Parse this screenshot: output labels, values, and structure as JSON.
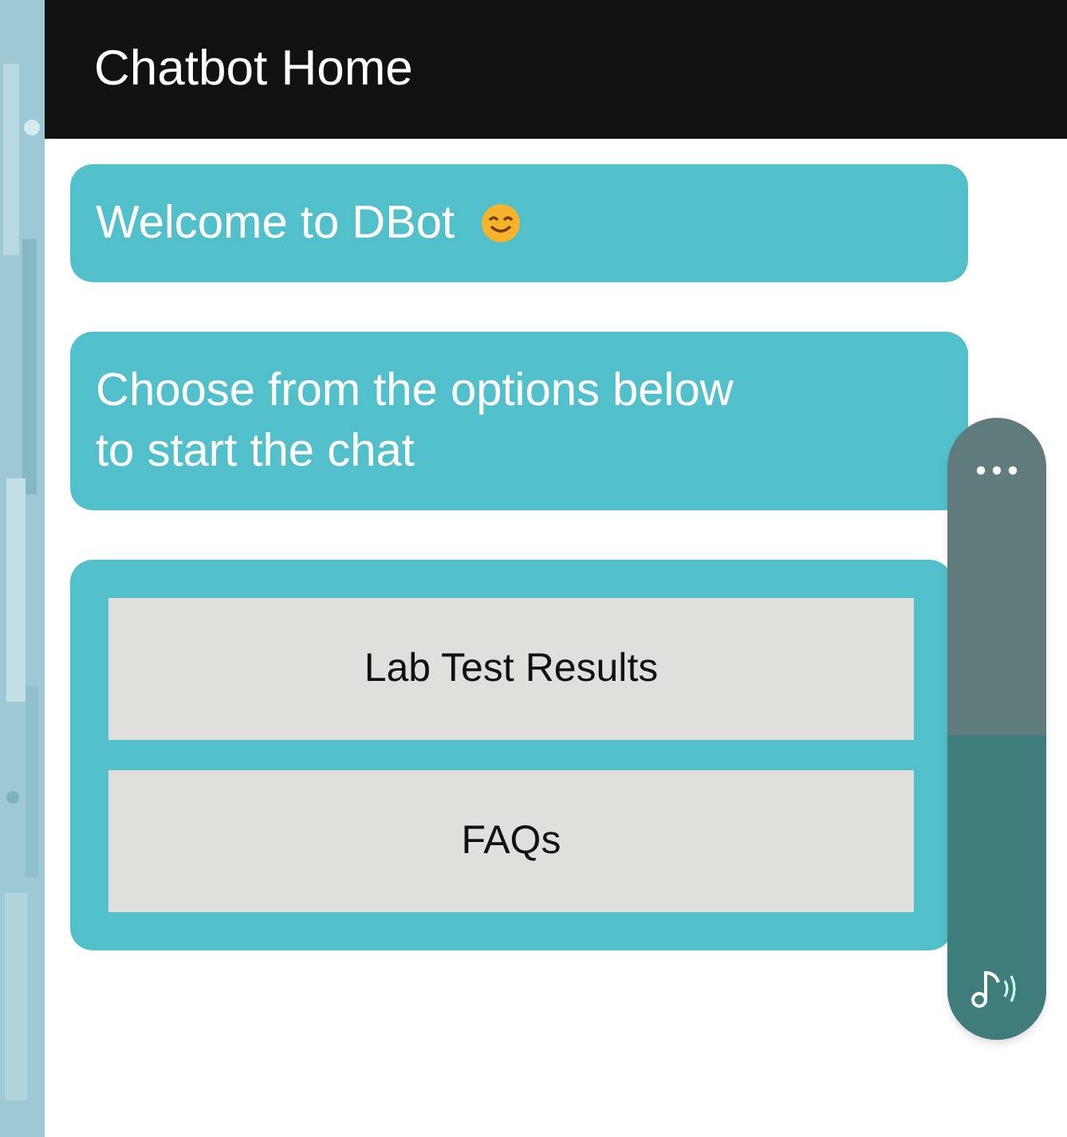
{
  "header": {
    "title": "Chatbot Home"
  },
  "messages": [
    {
      "text": "Welcome to DBot",
      "emoji": true
    },
    {
      "text": "Choose from the options below to start the chat",
      "emoji": false
    }
  ],
  "options": [
    "Lab Test Results",
    "FAQs"
  ],
  "volume": {
    "level": 0.49
  }
}
